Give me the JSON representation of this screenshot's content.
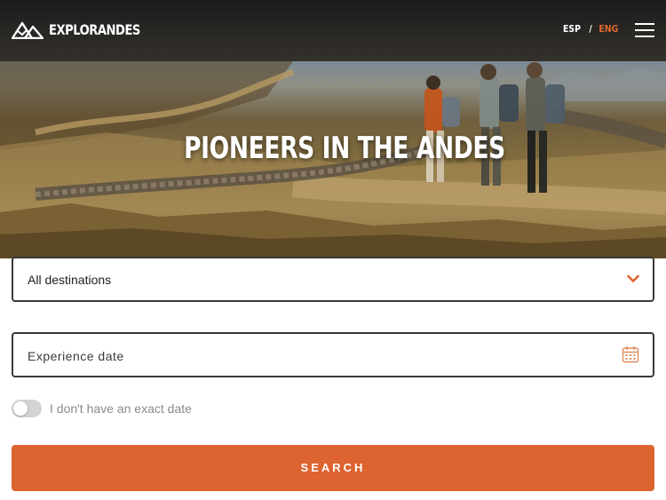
{
  "header": {
    "brand": "EXPLORANDES",
    "lang_esp": "ESP",
    "lang_sep": "/",
    "lang_eng": "ENG",
    "lang_active_color": "#e0692e",
    "logo_icon": "mountain-logo-icon",
    "menu_icon": "hamburger-menu-icon"
  },
  "hero": {
    "title": "PIONEERS IN THE ANDES"
  },
  "form": {
    "destination": {
      "value": "All destinations",
      "icon": "chevron-down-icon"
    },
    "date": {
      "placeholder": "Experience date",
      "icon": "calendar-icon"
    },
    "no_exact_date": {
      "label": "I don't have an exact date",
      "checked": false
    },
    "search_label": "SEARCH",
    "accent_color": "#dd6330"
  }
}
